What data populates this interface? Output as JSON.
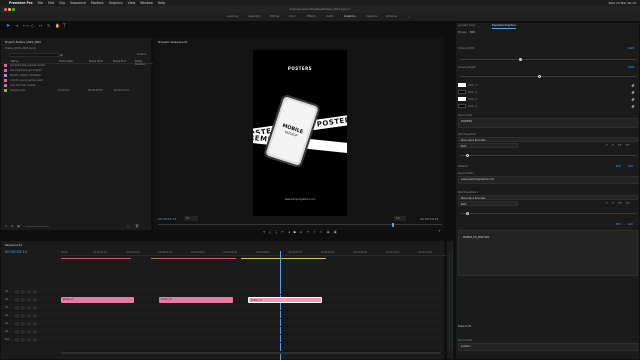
{
  "menubar": {
    "app": "Premiere Pro",
    "items": [
      "File",
      "Edit",
      "Clip",
      "Sequence",
      "Markers",
      "Graphics",
      "View",
      "Window",
      "Help"
    ],
    "clock": "Wed 13 Mar  20:19"
  },
  "window": {
    "path": "/Users/premiere/Desktop/Posters_2024.prproj *"
  },
  "workspaces": [
    "Learning",
    "Assembly",
    "Editing",
    "Color",
    "Effects",
    "Audio",
    "Graphics",
    "Captions",
    "Libraries"
  ],
  "active_workspace": "Graphics",
  "project": {
    "tab": "Project: Posters_2024_2023",
    "subtitle": "Posters_2024_2023.prproj",
    "count": "6 items",
    "headers": [
      "Name",
      "Frame Rate",
      "Media Start",
      "Media End",
      "Media Duration"
    ],
    "rows": [
      {
        "name": "girl-black-hair-outside-mobile",
        "c2": "",
        "c3": "",
        "c4": "",
        "color": "#d66ba1"
      },
      {
        "name": "Dancing Scene girl rhythm",
        "c2": "",
        "c3": "",
        "c4": "",
        "color": "#d66ba1"
      },
      {
        "name": "Modern Graphic Template",
        "c2": "",
        "c3": "",
        "c4": "",
        "color": "#b17fd4"
      },
      {
        "name": "colorful young women walk",
        "c2": "",
        "c3": "",
        "c4": "",
        "color": "#d66ba1"
      },
      {
        "name": "man hair hair outside",
        "c2": "",
        "c3": "",
        "c4": "",
        "color": "#d66ba1"
      },
      {
        "name": "Sequence 01",
        "c2": "25.00 fps",
        "c3": "00:00:00:00",
        "c4": "00:00:10:24",
        "color": "#5fbf6b"
      }
    ]
  },
  "program": {
    "tab": "Program: Sequence 01",
    "timecode": "00:00:03:13",
    "fit": "Fit",
    "quality": "1/2",
    "duration": "00:00:10:24",
    "poster": {
      "heading": "POSTERS",
      "ribbon_text": "POSTER POSTER POSTER",
      "ribbon_text2": "PREMIUM",
      "phone_title": "MOBILE",
      "phone_sub": "MOCKUP",
      "footer": "www.premiumgraphics.com"
    }
  },
  "timeline": {
    "tab": "Sequence 01",
    "timecode": "00:00:03:13",
    "ruler": [
      "00:00",
      "00:00:01:00",
      "00:00:02:00",
      "00:00:03:00",
      "00:00:04:00",
      "00:00:05:00",
      "00:00:06:00",
      "00:00:07:00",
      "00:00:08:00",
      "00:00:09:00",
      "00:00:10:00",
      "00:00:11:00"
    ],
    "tracks": [
      "V3",
      "V2",
      "V1",
      "A1",
      "A2",
      "A3",
      "Mix"
    ],
    "clips": [
      {
        "label": "Poster_v1"
      },
      {
        "label": "Poster_v2"
      },
      {
        "label": "Poster_v3"
      }
    ]
  },
  "essential_graphics": {
    "tabs": [
      "Essential Graphics",
      "Lumetri Color"
    ],
    "subtabs": [
      "Browse",
      "Edit"
    ],
    "items": [
      {
        "label": "Screen_Width",
        "value": "1920"
      },
      {
        "label": "Screen_Height",
        "value": "1080"
      },
      {
        "label": "Color_1"
      },
      {
        "label": "Color_2"
      },
      {
        "label": "Color_3"
      },
      {
        "label": "Color_4"
      }
    ],
    "sections": [
      {
        "label": "Source Text",
        "value": "POSTERS"
      },
      {
        "label": "Text Properties",
        "font": "Mona Sans Rounded",
        "style": "Bold"
      },
      {
        "label": "Rotation",
        "value": ""
      },
      {
        "label": "Source Text 2",
        "value": "www.premiumgraphics.com"
      },
      {
        "label": "Text Properties 2",
        "font": "Mona Sans Rounded",
        "style": "Bold"
      },
      {
        "label": "Replace",
        "value": "MOBILE_UP_POSITION"
      }
    ],
    "bottom": {
      "label": "Scale to Fit",
      "source": "Source Text",
      "source_value": "position"
    },
    "edit_label": "Edit",
    "add_label": "Add"
  }
}
